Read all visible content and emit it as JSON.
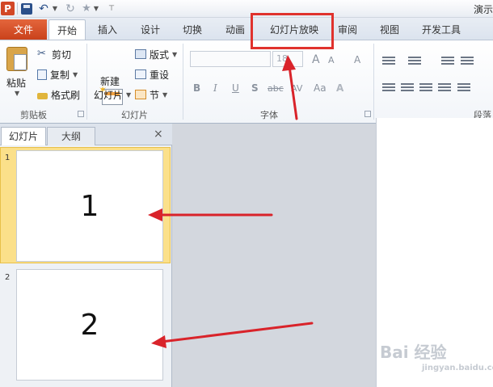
{
  "window": {
    "title": "演示"
  },
  "quick_access": {
    "app_letter": "P"
  },
  "tabs": {
    "file": "文件",
    "items": [
      "开始",
      "插入",
      "设计",
      "切换",
      "动画",
      "幻灯片放映",
      "审阅",
      "视图",
      "开发工具"
    ]
  },
  "ribbon": {
    "clipboard": {
      "paste": "粘贴",
      "cut": "剪切",
      "copy": "复制",
      "format_painter": "格式刷",
      "label": "剪贴板"
    },
    "slides": {
      "new_slide_1": "新建",
      "new_slide_2": "幻灯片",
      "layout": "版式",
      "reset": "重设",
      "section": "节",
      "label": "幻灯片"
    },
    "font": {
      "size": "18",
      "grow": "A",
      "shrink": "A",
      "clear": "A",
      "bold": "B",
      "italic": "I",
      "underline": "U",
      "shadow": "S",
      "strike": "abc",
      "spacing": "AV",
      "case": "Aa",
      "label": "字体"
    },
    "paragraph": {
      "label": "段落"
    }
  },
  "pane": {
    "tab_slides": "幻灯片",
    "tab_outline": "大纲",
    "close": "×",
    "thumbnails": [
      {
        "number": "1",
        "content": "1"
      },
      {
        "number": "2",
        "content": "2"
      }
    ]
  },
  "watermark": {
    "main": "Bai 经验",
    "sub": "jingyan.baidu.com"
  },
  "colors": {
    "file_tab": "#d24726",
    "highlight": "#e0322d",
    "selected_thumb": "#fbe08a",
    "arrow": "#d9232a"
  }
}
